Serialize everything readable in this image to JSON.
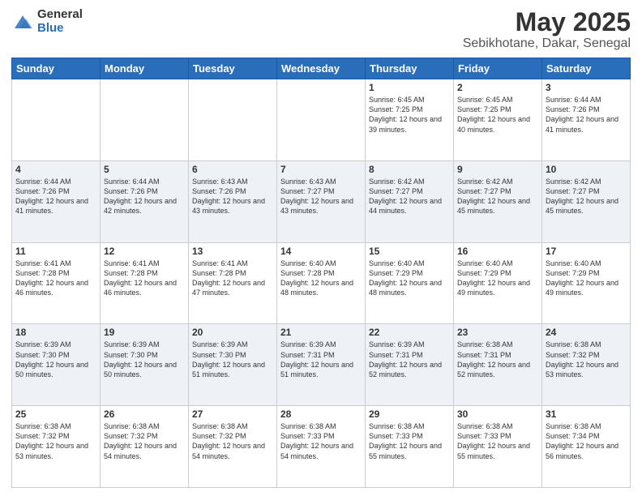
{
  "header": {
    "logo_general": "General",
    "logo_blue": "Blue",
    "title": "May 2025",
    "subtitle": "Sebikhotane, Dakar, Senegal"
  },
  "days": [
    "Sunday",
    "Monday",
    "Tuesday",
    "Wednesday",
    "Thursday",
    "Friday",
    "Saturday"
  ],
  "weeks": [
    [
      {
        "num": "",
        "sunrise": "",
        "sunset": "",
        "daylight": ""
      },
      {
        "num": "",
        "sunrise": "",
        "sunset": "",
        "daylight": ""
      },
      {
        "num": "",
        "sunrise": "",
        "sunset": "",
        "daylight": ""
      },
      {
        "num": "",
        "sunrise": "",
        "sunset": "",
        "daylight": ""
      },
      {
        "num": "1",
        "sunrise": "Sunrise: 6:45 AM",
        "sunset": "Sunset: 7:25 PM",
        "daylight": "Daylight: 12 hours and 39 minutes."
      },
      {
        "num": "2",
        "sunrise": "Sunrise: 6:45 AM",
        "sunset": "Sunset: 7:25 PM",
        "daylight": "Daylight: 12 hours and 40 minutes."
      },
      {
        "num": "3",
        "sunrise": "Sunrise: 6:44 AM",
        "sunset": "Sunset: 7:26 PM",
        "daylight": "Daylight: 12 hours and 41 minutes."
      }
    ],
    [
      {
        "num": "4",
        "sunrise": "Sunrise: 6:44 AM",
        "sunset": "Sunset: 7:26 PM",
        "daylight": "Daylight: 12 hours and 41 minutes."
      },
      {
        "num": "5",
        "sunrise": "Sunrise: 6:44 AM",
        "sunset": "Sunset: 7:26 PM",
        "daylight": "Daylight: 12 hours and 42 minutes."
      },
      {
        "num": "6",
        "sunrise": "Sunrise: 6:43 AM",
        "sunset": "Sunset: 7:26 PM",
        "daylight": "Daylight: 12 hours and 43 minutes."
      },
      {
        "num": "7",
        "sunrise": "Sunrise: 6:43 AM",
        "sunset": "Sunset: 7:27 PM",
        "daylight": "Daylight: 12 hours and 43 minutes."
      },
      {
        "num": "8",
        "sunrise": "Sunrise: 6:42 AM",
        "sunset": "Sunset: 7:27 PM",
        "daylight": "Daylight: 12 hours and 44 minutes."
      },
      {
        "num": "9",
        "sunrise": "Sunrise: 6:42 AM",
        "sunset": "Sunset: 7:27 PM",
        "daylight": "Daylight: 12 hours and 45 minutes."
      },
      {
        "num": "10",
        "sunrise": "Sunrise: 6:42 AM",
        "sunset": "Sunset: 7:27 PM",
        "daylight": "Daylight: 12 hours and 45 minutes."
      }
    ],
    [
      {
        "num": "11",
        "sunrise": "Sunrise: 6:41 AM",
        "sunset": "Sunset: 7:28 PM",
        "daylight": "Daylight: 12 hours and 46 minutes."
      },
      {
        "num": "12",
        "sunrise": "Sunrise: 6:41 AM",
        "sunset": "Sunset: 7:28 PM",
        "daylight": "Daylight: 12 hours and 46 minutes."
      },
      {
        "num": "13",
        "sunrise": "Sunrise: 6:41 AM",
        "sunset": "Sunset: 7:28 PM",
        "daylight": "Daylight: 12 hours and 47 minutes."
      },
      {
        "num": "14",
        "sunrise": "Sunrise: 6:40 AM",
        "sunset": "Sunset: 7:28 PM",
        "daylight": "Daylight: 12 hours and 48 minutes."
      },
      {
        "num": "15",
        "sunrise": "Sunrise: 6:40 AM",
        "sunset": "Sunset: 7:29 PM",
        "daylight": "Daylight: 12 hours and 48 minutes."
      },
      {
        "num": "16",
        "sunrise": "Sunrise: 6:40 AM",
        "sunset": "Sunset: 7:29 PM",
        "daylight": "Daylight: 12 hours and 49 minutes."
      },
      {
        "num": "17",
        "sunrise": "Sunrise: 6:40 AM",
        "sunset": "Sunset: 7:29 PM",
        "daylight": "Daylight: 12 hours and 49 minutes."
      }
    ],
    [
      {
        "num": "18",
        "sunrise": "Sunrise: 6:39 AM",
        "sunset": "Sunset: 7:30 PM",
        "daylight": "Daylight: 12 hours and 50 minutes."
      },
      {
        "num": "19",
        "sunrise": "Sunrise: 6:39 AM",
        "sunset": "Sunset: 7:30 PM",
        "daylight": "Daylight: 12 hours and 50 minutes."
      },
      {
        "num": "20",
        "sunrise": "Sunrise: 6:39 AM",
        "sunset": "Sunset: 7:30 PM",
        "daylight": "Daylight: 12 hours and 51 minutes."
      },
      {
        "num": "21",
        "sunrise": "Sunrise: 6:39 AM",
        "sunset": "Sunset: 7:31 PM",
        "daylight": "Daylight: 12 hours and 51 minutes."
      },
      {
        "num": "22",
        "sunrise": "Sunrise: 6:39 AM",
        "sunset": "Sunset: 7:31 PM",
        "daylight": "Daylight: 12 hours and 52 minutes."
      },
      {
        "num": "23",
        "sunrise": "Sunrise: 6:38 AM",
        "sunset": "Sunset: 7:31 PM",
        "daylight": "Daylight: 12 hours and 52 minutes."
      },
      {
        "num": "24",
        "sunrise": "Sunrise: 6:38 AM",
        "sunset": "Sunset: 7:32 PM",
        "daylight": "Daylight: 12 hours and 53 minutes."
      }
    ],
    [
      {
        "num": "25",
        "sunrise": "Sunrise: 6:38 AM",
        "sunset": "Sunset: 7:32 PM",
        "daylight": "Daylight: 12 hours and 53 minutes."
      },
      {
        "num": "26",
        "sunrise": "Sunrise: 6:38 AM",
        "sunset": "Sunset: 7:32 PM",
        "daylight": "Daylight: 12 hours and 54 minutes."
      },
      {
        "num": "27",
        "sunrise": "Sunrise: 6:38 AM",
        "sunset": "Sunset: 7:32 PM",
        "daylight": "Daylight: 12 hours and 54 minutes."
      },
      {
        "num": "28",
        "sunrise": "Sunrise: 6:38 AM",
        "sunset": "Sunset: 7:33 PM",
        "daylight": "Daylight: 12 hours and 54 minutes."
      },
      {
        "num": "29",
        "sunrise": "Sunrise: 6:38 AM",
        "sunset": "Sunset: 7:33 PM",
        "daylight": "Daylight: 12 hours and 55 minutes."
      },
      {
        "num": "30",
        "sunrise": "Sunrise: 6:38 AM",
        "sunset": "Sunset: 7:33 PM",
        "daylight": "Daylight: 12 hours and 55 minutes."
      },
      {
        "num": "31",
        "sunrise": "Sunrise: 6:38 AM",
        "sunset": "Sunset: 7:34 PM",
        "daylight": "Daylight: 12 hours and 56 minutes."
      }
    ]
  ]
}
